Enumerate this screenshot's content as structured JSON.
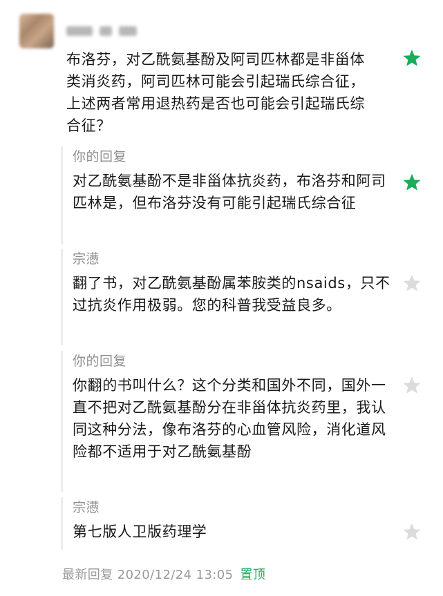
{
  "comment": {
    "avatar": "avatar",
    "text": "布洛芬，对乙酰氨基酚及阿司匹林都是非甾体类消炎药，阿司匹林可能会引起瑞氏综合征，上述两者常用退热药是否也可能会引起瑞氏综合征？",
    "starred": true
  },
  "replies": [
    {
      "author": "你的回复",
      "text": "对乙酰氨基酚不是非甾体抗炎药，布洛芬和阿司匹林是，但布洛芬没有可能引起瑞氏综合征",
      "starred": true
    },
    {
      "author": "宗懑",
      "text": "翻了书，对乙酰氨基酚属苯胺类的nsaids，只不过抗炎作用极弱。您的科普我受益良多。",
      "starred": false
    },
    {
      "author": "你的回复",
      "text": "你翻的书叫什么？这个分类和国外不同，国外一直不把对乙酰氨基酚分在非甾体抗炎药里，我认同这种分法，像布洛芬的心血管风险，消化道风险都不适用于对乙酰氨基酚",
      "starred": false
    },
    {
      "author": "宗懑",
      "text": "第七版人卫版药理学",
      "starred": false
    }
  ],
  "footer": {
    "label": "最新回复 2020/12/24 13:05",
    "pin": "置顶"
  },
  "colors": {
    "star_active": "#1aad5a",
    "star_inactive": "#dcdcdc",
    "pin": "#1aad5a"
  }
}
